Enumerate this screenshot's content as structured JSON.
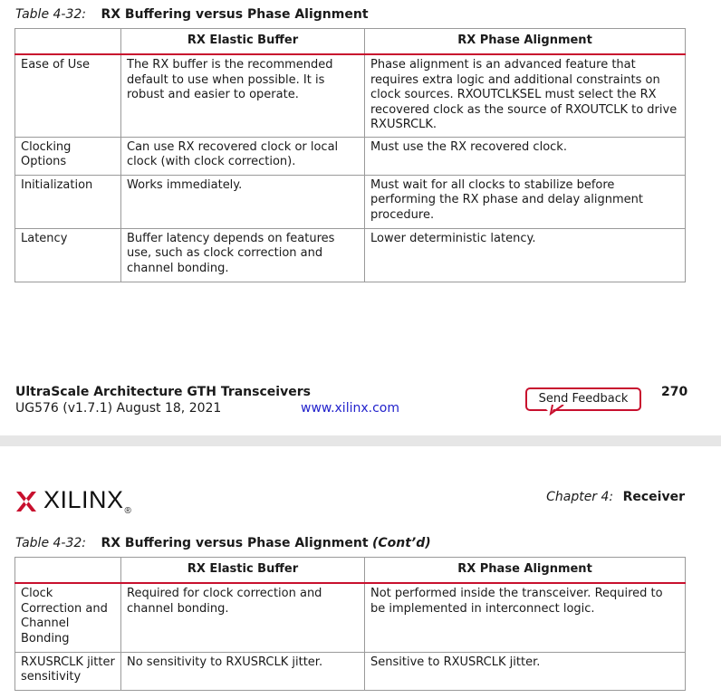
{
  "page1": {
    "table_number": "Table 4-32:",
    "table_title": "RX Buffering versus Phase Alignment",
    "headers": [
      "",
      "RX Elastic Buffer",
      "RX Phase Alignment"
    ],
    "rows": [
      [
        "Ease of Use",
        "The RX buffer is the recommended default to use when possible. It is robust and easier to operate.",
        "Phase alignment is an advanced feature that requires extra logic and additional constraints on clock sources. RXOUTCLKSEL must select the RX recovered clock as the source of RXOUTCLK to drive RXUSRCLK."
      ],
      [
        "Clocking Options",
        "Can use RX recovered clock or local clock (with clock correction).",
        "Must use the RX recovered clock."
      ],
      [
        "Initialization",
        "Works immediately.",
        "Must wait for all clocks to stabilize before performing the RX phase and delay alignment procedure."
      ],
      [
        "Latency",
        "Buffer latency depends on features use, such as clock correction and channel bonding.",
        "Lower deterministic latency."
      ]
    ]
  },
  "footer": {
    "doc_title": "UltraScale Architecture GTH Transceivers",
    "doc_id": "UG576 (v1.7.1) August 18, 2021",
    "url": "www.xilinx.com",
    "feedback_label": "Send Feedback",
    "page_number": "270"
  },
  "header2": {
    "logo_text": "XILINX",
    "logo_reg": "®",
    "chapter_label": "Chapter 4:",
    "chapter_name": "Receiver"
  },
  "page2": {
    "table_number": "Table 4-32:",
    "table_title": "RX Buffering versus Phase Alignment",
    "contd": "(Cont’d)",
    "headers": [
      "",
      "RX Elastic Buffer",
      "RX Phase Alignment"
    ],
    "rows": [
      [
        "Clock Correction and Channel Bonding",
        "Required for clock correction and channel bonding.",
        "Not performed inside the transceiver. Required to be implemented in interconnect logic."
      ],
      [
        "RXUSRCLK jitter sensitivity",
        "No sensitivity to RXUSRCLK jitter.",
        "Sensitive to RXUSRCLK jitter."
      ]
    ]
  },
  "colors": {
    "accent": "#c8102e",
    "link": "#2222cc",
    "gap": "#e6e6e6"
  }
}
